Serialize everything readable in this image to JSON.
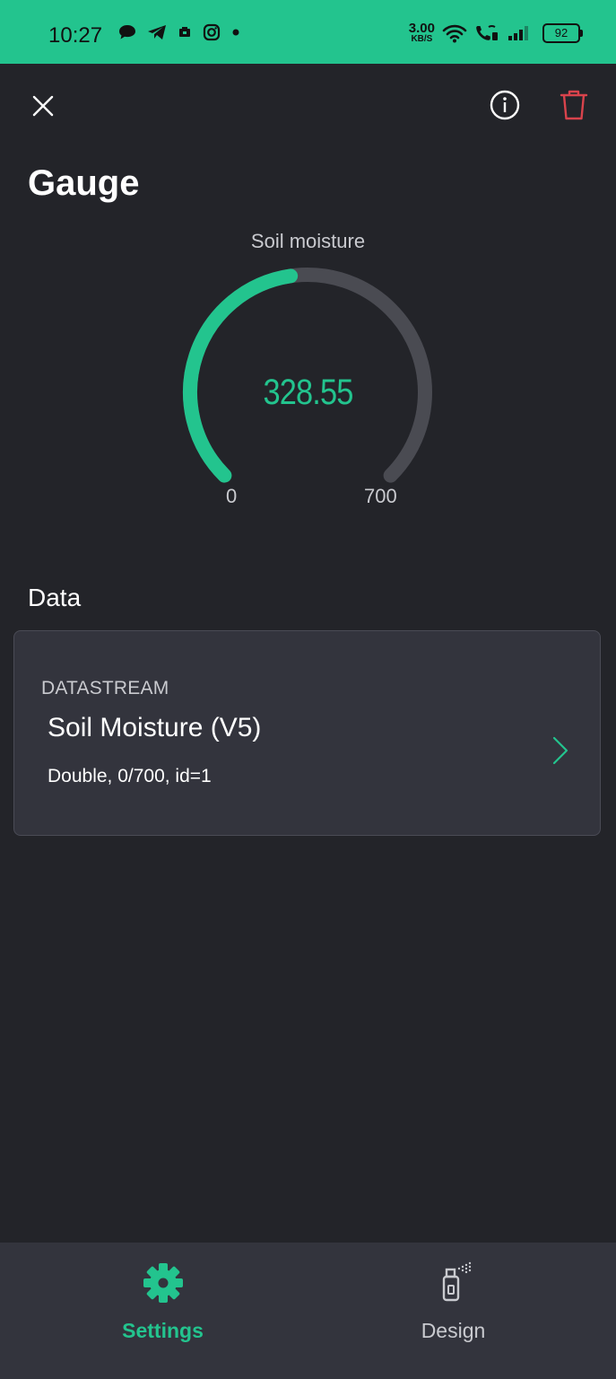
{
  "status_bar": {
    "time": "10:27",
    "net_speed_value": "3.00",
    "net_speed_unit": "KB/S",
    "battery": "92",
    "left_icons": [
      "chat-bubble-icon",
      "telegram-icon",
      "notification-icon",
      "instagram-icon",
      "dot-icon"
    ],
    "right_icons": [
      "wifi-icon",
      "wifi-call-icon",
      "signal-icon",
      "battery-icon"
    ]
  },
  "toolbar": {
    "close_icon": "close-icon",
    "info_icon": "info-icon",
    "delete_icon": "trash-icon"
  },
  "page": {
    "title": "Gauge"
  },
  "gauge": {
    "label": "Soil moisture",
    "value": "328.55",
    "min": "0",
    "max": "700",
    "value_numeric": 328.55,
    "min_numeric": 0,
    "max_numeric": 700,
    "accent_color": "#23c48e",
    "track_color": "#4a4b52"
  },
  "data_section": {
    "title": "Data",
    "datastream": {
      "caption": "DATASTREAM",
      "name": "Soil Moisture (V5)",
      "meta": "Double, 0/700, id=1",
      "chevron_icon": "chevron-right-icon"
    }
  },
  "bottom_nav": {
    "items": [
      {
        "label": "Settings",
        "icon": "gear-icon",
        "active": true
      },
      {
        "label": "Design",
        "icon": "spray-can-icon",
        "active": false
      }
    ]
  },
  "colors": {
    "accent": "#23c48e",
    "background": "#232429",
    "card": "#33343d",
    "danger": "#d9434c"
  }
}
